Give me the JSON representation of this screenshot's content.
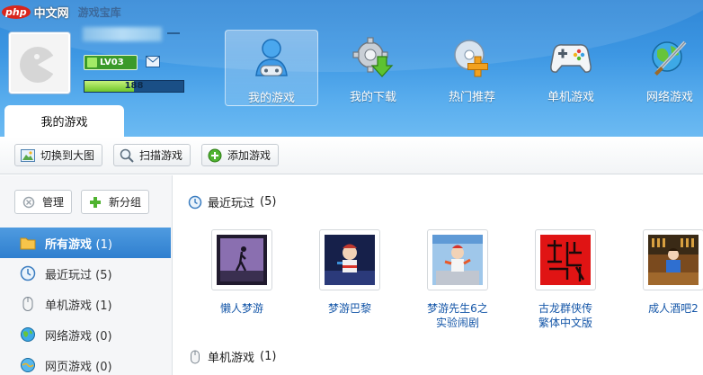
{
  "watermark": {
    "logo": "php",
    "text": "中文网",
    "sub": "游戏宝库"
  },
  "user": {
    "level": "LV03",
    "exp_text": "188",
    "exp_fraction": 0.5
  },
  "nav": [
    {
      "label": "我的游戏",
      "icon": "user-gamepad-icon",
      "active": true
    },
    {
      "label": "我的下载",
      "icon": "gear-download-icon"
    },
    {
      "label": "热门推荐",
      "icon": "plus-disc-icon"
    },
    {
      "label": "单机游戏",
      "icon": "gamepad-icon"
    },
    {
      "label": "网络游戏",
      "icon": "globe-sword-icon"
    }
  ],
  "main_tab": "我的游戏",
  "toolbar": {
    "switch_view": "切换到大图",
    "scan": "扫描游戏",
    "add": "添加游戏"
  },
  "sidebar": {
    "manage": "管理",
    "new_group": "新分组",
    "items": [
      {
        "label": "所有游戏",
        "count": "(1)",
        "icon": "folder-icon",
        "active": true
      },
      {
        "label": "最近玩过",
        "count": "(5)",
        "icon": "clock-icon"
      },
      {
        "label": "单机游戏",
        "count": "(1)",
        "icon": "mouse-icon"
      },
      {
        "label": "网络游戏",
        "count": "(0)",
        "icon": "globe-icon"
      },
      {
        "label": "网页游戏",
        "count": "(0)",
        "icon": "web-globe-icon"
      }
    ]
  },
  "content": {
    "recent_title": "最近玩过",
    "recent_count": "(5)",
    "single_title": "单机游戏",
    "single_count": "(1)",
    "games": [
      {
        "name": "懒人梦游"
      },
      {
        "name": "梦游巴黎"
      },
      {
        "name": "梦游先生6之\n实验闹剧"
      },
      {
        "name": "古龙群侠传\n繁体中文版"
      },
      {
        "name": "成人酒吧2"
      }
    ]
  },
  "colors": {
    "header": "#3d97e3",
    "active_side": "#3a8ad8",
    "link": "#1456a8"
  }
}
